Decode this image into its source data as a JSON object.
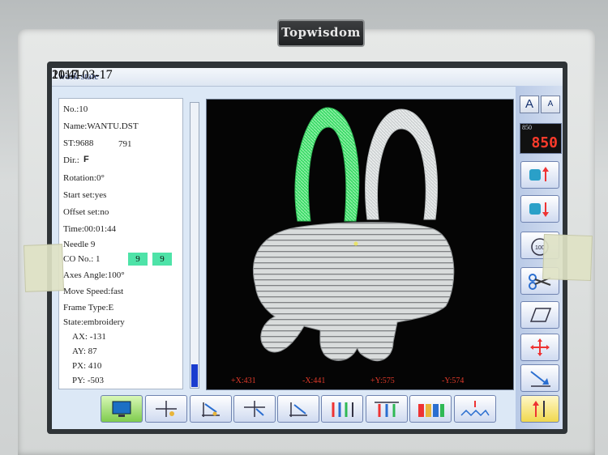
{
  "device": {
    "brand": "Topwisdom"
  },
  "window": {
    "title": "work  state",
    "date": "2017-03-17",
    "time": "11:41"
  },
  "info": {
    "no": "No.:10",
    "name": "Name:WANTU.DST",
    "st": "ST:9688",
    "st_current": "791",
    "dir_label": "Dir.:",
    "dir_value": "F",
    "rotation": "Rotation:0°",
    "start_set": "Start  set:yes",
    "offset_set": "Offset  set:no",
    "time": "Time:00:01:44",
    "needle": "Needle 9",
    "co_label": "CO  No.:  1",
    "co_a": "9",
    "co_b": "9",
    "axes_angle": "Axes  Angle:100°",
    "move_speed": "Move  Speed:fast",
    "frame_type": "Frame  Type:E",
    "state": "State:embroidery",
    "ax": "AX: -131",
    "ay": "AY: 87",
    "px": "PX: 410",
    "py": "PY: -503"
  },
  "progress": {
    "fraction": 0.08
  },
  "coords": {
    "xplus": "+X:431",
    "xminus": "-X:441",
    "yplus": "+Y:575",
    "yminus": "-Y:574"
  },
  "side": {
    "font_large": "A",
    "font_small": "A",
    "speed_label": "850",
    "speed_value": "850",
    "buttons": [
      "speed-up-icon",
      "speed-down-icon",
      "dial-icon",
      "scissors-icon",
      "frame-icon",
      "move-arrows-icon",
      "origin-icon",
      "thread-up-icon"
    ]
  },
  "toolbar": {
    "icons": [
      "monitor-icon",
      "set-start-icon",
      "frame-shift-icon",
      "return-start-icon",
      "return-origin-icon",
      "needle-select-icon",
      "color-change-icon",
      "thread-color-icon",
      "stitch-pattern-icon"
    ]
  }
}
